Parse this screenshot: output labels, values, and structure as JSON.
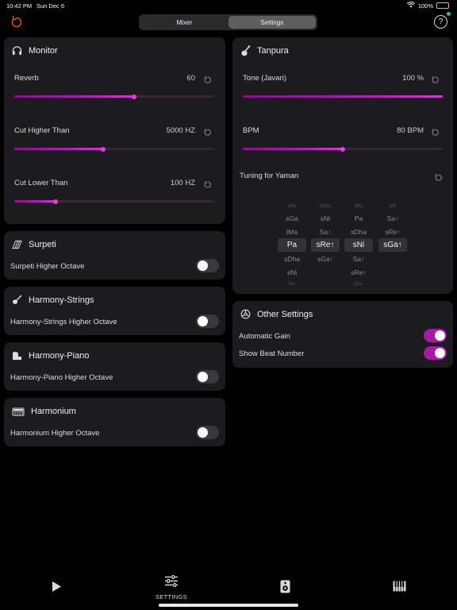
{
  "status": {
    "time": "10:42 PM",
    "date": "Sun Dec 6",
    "battery": "100%"
  },
  "segmented": {
    "options": [
      "Mixer",
      "Settings"
    ],
    "selected": "Settings"
  },
  "help_label": "?",
  "monitor": {
    "title": "Monitor",
    "params": [
      {
        "label": "Reverb",
        "value": "60",
        "level": 0.6
      },
      {
        "label": "Cut Higher Than",
        "value": "5000 HZ",
        "level": 0.445
      },
      {
        "label": "Cut Lower Than",
        "value": "100 HZ",
        "level": 0.205
      }
    ]
  },
  "surpeti": {
    "title": "Surpeti",
    "toggle_label": "Surpeti Higher Octave",
    "on": false
  },
  "harmony_strings": {
    "title": "Harmony-Strings",
    "toggle_label": "Harmony-Strings Higher Octave",
    "on": false
  },
  "harmony_piano": {
    "title": "Harmony-Piano",
    "toggle_label": "Harmony-Piano Higher Octave",
    "on": false
  },
  "harmonium": {
    "title": "Harmonium",
    "toggle_label": "Harmonium Higher Octave",
    "on": false
  },
  "tanpura": {
    "title": "Tanpura",
    "tone": {
      "label": "Tone (Javari)",
      "value": "100 %",
      "level": 1.0
    },
    "bpm": {
      "label": "BPM",
      "value": "80 BPM",
      "level": 0.5
    },
    "tuning_label": "Tuning for Yaman",
    "picker": [
      {
        "top": "sRe",
        "cells": [
          "sGa",
          "tMa",
          "Pa",
          "sDha",
          "sNi"
        ],
        "bottom": "Sa↑"
      },
      {
        "top": "sDha",
        "cells": [
          "sNi",
          "Sa↑",
          "sRe↑",
          "sGa↑",
          ""
        ],
        "bottom": ""
      },
      {
        "top": "tMa",
        "cells": [
          "Pa",
          "sDha",
          "sNi",
          "Sa↑",
          "sRe↑"
        ],
        "bottom": "sGa↑"
      },
      {
        "top": "sNi",
        "cells": [
          "Sa↑",
          "sRe↑",
          "sGa↑",
          "",
          ""
        ],
        "bottom": ""
      }
    ]
  },
  "other_settings": {
    "title": "Other Settings",
    "toggles": [
      {
        "label": "Automatic Gain",
        "on": true
      },
      {
        "label": "Show Beat Number",
        "on": true
      }
    ]
  },
  "tabbar": {
    "settings_label": "SETTINGS"
  },
  "colors": {
    "accent": "#b81ab6",
    "card": "#1c1c1e",
    "background": "#000000",
    "reset_red": "#e0453a"
  }
}
